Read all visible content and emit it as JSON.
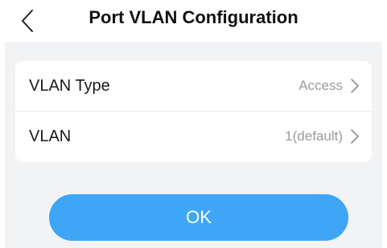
{
  "header": {
    "title": "Port VLAN Configuration",
    "back_icon": "chevron-left-icon"
  },
  "settings": {
    "rows": [
      {
        "label": "VLAN Type",
        "value": "Access",
        "icon": "chevron-right-icon"
      },
      {
        "label": "VLAN",
        "value": "1(default)",
        "icon": "chevron-right-icon"
      }
    ]
  },
  "actions": {
    "ok_label": "OK"
  },
  "colors": {
    "accent": "#3ea6f5",
    "background": "#f2f3f5",
    "value_text": "#9a9a9e"
  }
}
